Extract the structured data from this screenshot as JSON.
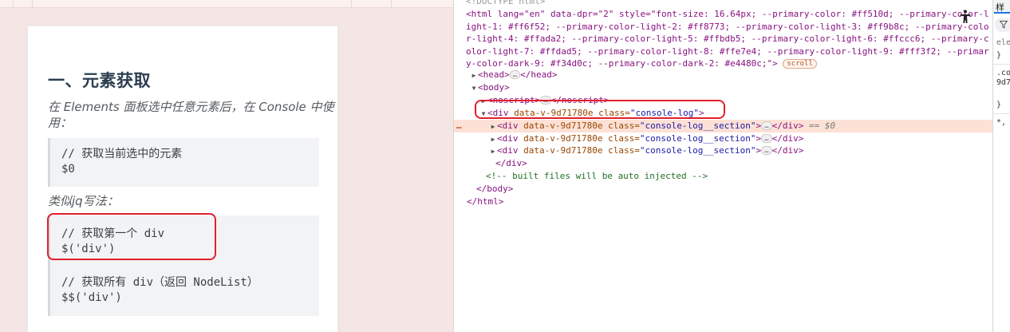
{
  "article": {
    "heading": "一、元素获取",
    "para1_line1": "在 Elements 面板选中任意元素后，在 Console 中使",
    "para1_line2": "用：",
    "code1": [
      "// 获取当前选中的元素",
      "$0"
    ],
    "para2": "类似jq写法：",
    "code2": [
      "// 获取第一个 div",
      "$('div')",
      "",
      "",
      "// 获取所有 div（返回 NodeList）",
      "$$('div')"
    ]
  },
  "devtools": {
    "line0": "<!DOCTYPE html>",
    "html_open_1": "<html lang=\"en\" data-dpr=\"2\" style=\"font-size: 16.64px; --primary-color: #ff510d; --primary-color-l",
    "html_open_2": "ight-1: #ff6f52; --primary-color-light-2: #ff8773; --primary-color-light-3: #ff9b8c; --primary-colo",
    "html_open_3": "r-light-4: #ffada2; --primary-color-light-5: #ffbdb5; --primary-color-light-6: #ffccc6; --primary-c",
    "html_open_4": "olor-light-7: #ffdad5; --primary-color-light-8: #ffe7e4; --primary-color-light-9: #fff3f2; --primar",
    "html_open_5": "y-color-dark-9: #f34d0c; --primary-color-dark-2: #e4480c;\">",
    "scroll_badge": "scroll",
    "head": "<head>",
    "head_close": "</head>",
    "body": "<body>",
    "noscript": "<noscript>",
    "noscript_close": "</noscript>",
    "div_open": "<div ",
    "attr_name": "data-v-9d71780e",
    "class_attr": "class=",
    "class_console_log": "\"console-log\"",
    "class_section": "\"console-log__section\"",
    "gt": ">",
    "div_close": "</div>",
    "eq_marker": "== ",
    "dollar0": "$0",
    "ellipsis": "…",
    "dots": "…",
    "comment": "<!-- built files will be auto injected -->",
    "body_close": "</body>",
    "html_close": "</html>"
  },
  "styles_pane": {
    "tab": "样",
    "lines": [
      "ele",
      "}",
      ".co",
      "9d7",
      "}",
      "*,"
    ]
  }
}
